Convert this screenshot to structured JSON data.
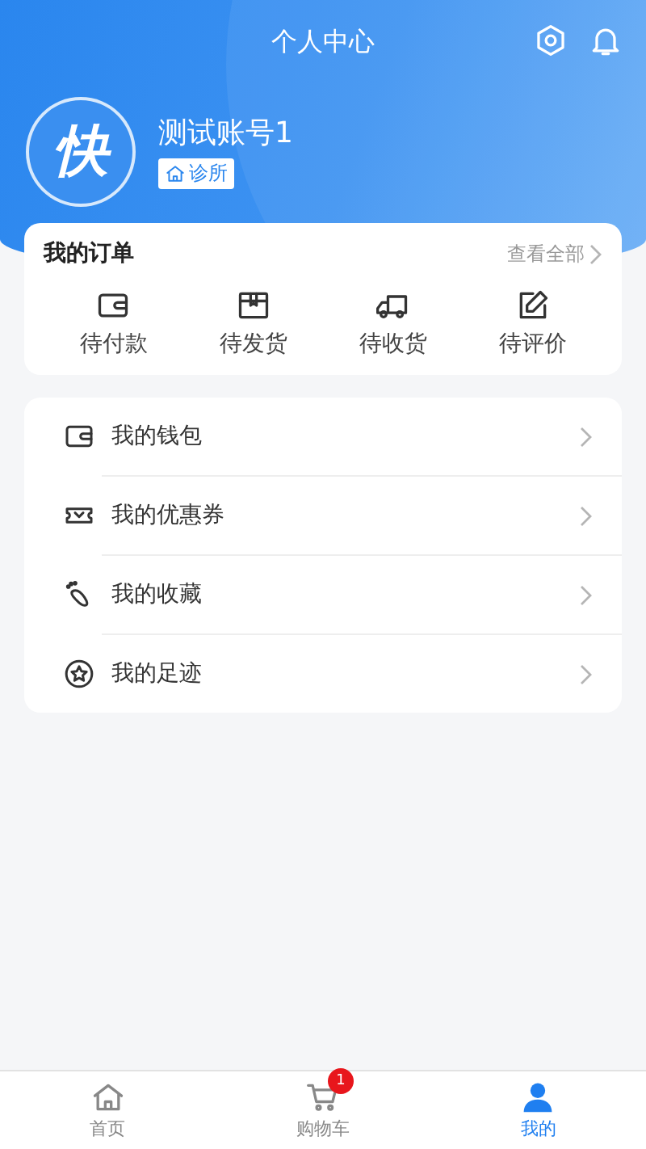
{
  "header": {
    "title": "个人中心",
    "avatar_text": "快",
    "user_name": "测试账号1",
    "tag": "诊所"
  },
  "orders": {
    "title": "我的订单",
    "view_all": "查看全部",
    "items": [
      {
        "kind": "wallet",
        "label": "待付款"
      },
      {
        "kind": "box",
        "label": "待发货"
      },
      {
        "kind": "truck",
        "label": "待收货"
      },
      {
        "kind": "edit",
        "label": "待评价"
      }
    ]
  },
  "menu": [
    {
      "kind": "wallet",
      "label": "我的钱包"
    },
    {
      "kind": "coupon",
      "label": "我的优惠券"
    },
    {
      "kind": "foot",
      "label": "我的收藏"
    },
    {
      "kind": "star",
      "label": "我的足迹"
    }
  ],
  "tab_bar": [
    {
      "kind": "home",
      "label": "首页",
      "selected": false
    },
    {
      "kind": "cart",
      "label": "购物车",
      "selected": false,
      "badge": "1"
    },
    {
      "kind": "user",
      "label": "我的",
      "selected": true
    }
  ]
}
